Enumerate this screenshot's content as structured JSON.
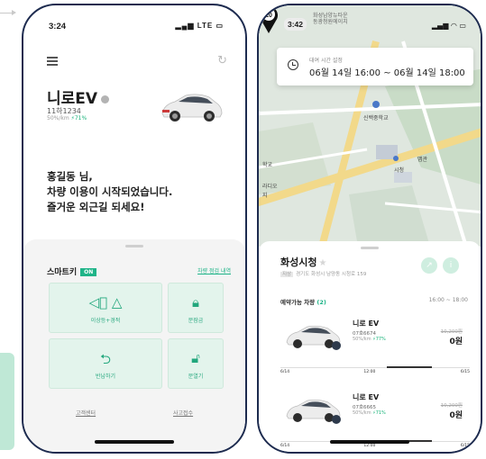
{
  "colors": {
    "accent": "#1fb488",
    "frame": "#1d2b4f",
    "key_bg": "#e3f4ec"
  },
  "left": {
    "status": {
      "time": "3:24",
      "icons": "LTE"
    },
    "car": {
      "name": "니로EV",
      "plate": "11하1234",
      "meter_prefix": "50%/km",
      "meter_pct": "71%"
    },
    "greeting": [
      "홍길동 님,",
      "차량 이용이 시작되었습니다.",
      "즐거운 외근길 되세요!"
    ],
    "smartkey": {
      "title": "스마트키",
      "badge": "ON",
      "link": "차량 점검 내역",
      "buttons": [
        {
          "label": "이상등+경적",
          "icon": "horn-light-icon"
        },
        {
          "label": "문잠금",
          "icon": "lock-icon"
        },
        {
          "label": "반납하기",
          "icon": "return-icon"
        },
        {
          "label": "문열기",
          "icon": "unlock-icon"
        }
      ]
    },
    "links": {
      "support": "고객센터",
      "accident": "사고접수"
    }
  },
  "right": {
    "status": {
      "time": "3:42"
    },
    "map_top_text": [
      "화성남양뉴타운",
      "동광청원에이치"
    ],
    "reservation": {
      "label": "대여 시간 설정",
      "value": "06월 14일 16:00 ~ 06월 14일 18:00"
    },
    "map_labels": {
      "school": "신백중학교",
      "hall": "시청",
      "left1": "학교",
      "left2": "라디오",
      "left3": "지",
      "poi": "맵관"
    },
    "pin_number": "10",
    "place": {
      "name": "화성시청",
      "tag": "지상",
      "address": "경기도 화성시 남양동 시청로 159"
    },
    "available": {
      "label": "예약가능 차량",
      "count": "(2)",
      "time": "16:00 ~ 18:00"
    },
    "cars": [
      {
        "name": "니로 EV",
        "plate": "07호6674",
        "meter_prefix": "50%/km",
        "meter_pct": "77%",
        "old_price": "10,200원",
        "price": "0원",
        "timeline": [
          "6/14",
          "12:00",
          "6/15"
        ]
      },
      {
        "name": "니로 EV",
        "plate": "07호6665",
        "meter_prefix": "50%/km",
        "meter_pct": "71%",
        "old_price": "10,200원",
        "price": "0원",
        "timeline": [
          "6/14",
          "12:00",
          "6/15"
        ]
      }
    ]
  }
}
